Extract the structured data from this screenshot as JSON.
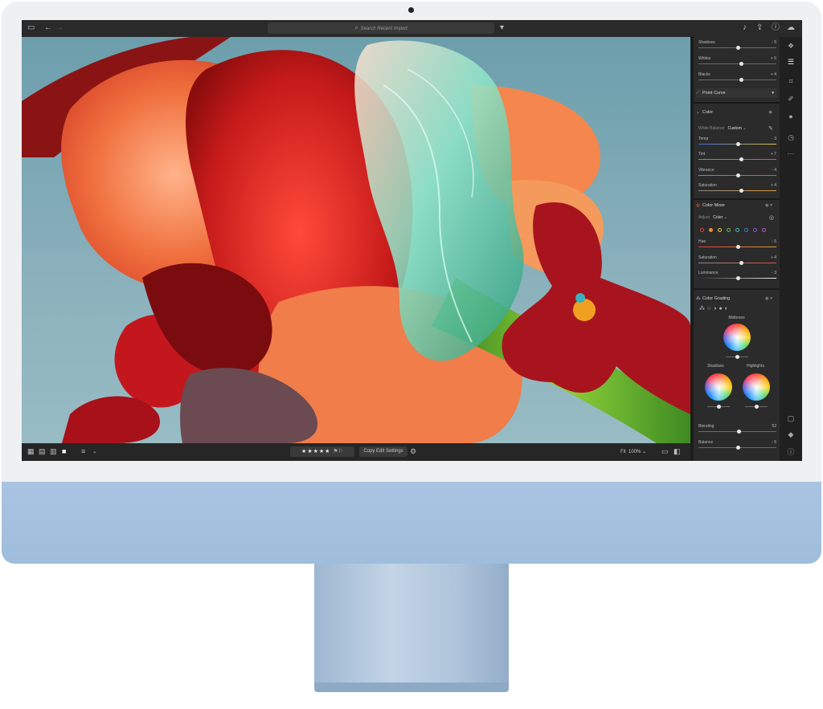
{
  "topbar": {
    "search_placeholder": "Search Recent Import"
  },
  "panel": {
    "tone_sliders": [
      {
        "label": "Shadows",
        "value": "- 5",
        "pos": 0.5
      },
      {
        "label": "Whites",
        "value": "+ 5",
        "pos": 0.55
      },
      {
        "label": "Blacks",
        "value": "+ 4",
        "pos": 0.55
      }
    ],
    "point_curve": "Point Curve",
    "color_section": "Color",
    "white_balance_label": "White Balance",
    "white_balance_value": "Custom",
    "color_sliders": [
      {
        "label": "Temp",
        "value": "- 3",
        "pos": 0.5
      },
      {
        "label": "Tint",
        "value": "+ 7",
        "pos": 0.55
      },
      {
        "label": "Vibrance",
        "value": "- 4",
        "pos": 0.5
      },
      {
        "label": "Saturation",
        "value": "+ 4",
        "pos": 0.55
      }
    ],
    "color_mixer": "Color Mixer",
    "adjust_label": "Adjust",
    "adjust_value": "Color",
    "mixer_colors": [
      "#e03a3a",
      "#f0902a",
      "#e6d230",
      "#5cc04a",
      "#3fb6a8",
      "#3a7fe0",
      "#8a55e0",
      "#d04fd0"
    ],
    "mixer_sliders": [
      {
        "label": "Hue",
        "value": "- 5",
        "pos": 0.5
      },
      {
        "label": "Saturation",
        "value": "+ 4",
        "pos": 0.55
      },
      {
        "label": "Luminance",
        "value": "- 3",
        "pos": 0.5
      }
    ],
    "color_grading": "Color Grading",
    "midtones": "Midtones",
    "shadows": "Shadows",
    "highlights": "Highlights",
    "blend_sliders": [
      {
        "label": "Blending",
        "value": "52",
        "pos": 0.52
      },
      {
        "label": "Balance",
        "value": "- 5",
        "pos": 0.5
      }
    ]
  },
  "bottombar": {
    "stars": "★★★★★",
    "copy_edit": "Copy Edit Settings",
    "fit_label": "Fit",
    "zoom": "100%"
  }
}
